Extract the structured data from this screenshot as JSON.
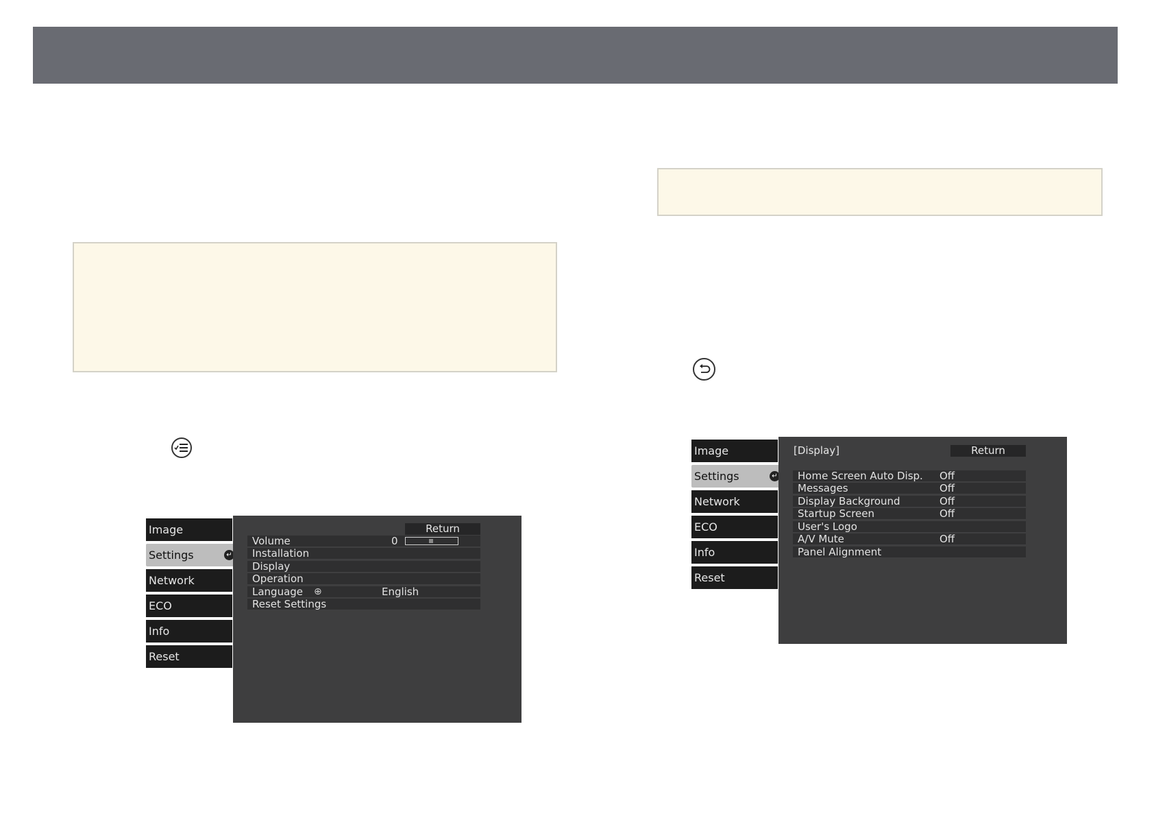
{
  "menu_screen_left": {
    "tabs": [
      "Image",
      "Settings",
      "Network",
      "ECO",
      "Info",
      "Reset"
    ],
    "active_tab": "Settings",
    "return_label": "Return",
    "rows": [
      {
        "label": "Volume",
        "value": "0"
      },
      {
        "label": "Installation",
        "value": ""
      },
      {
        "label": "Display",
        "value": ""
      },
      {
        "label": "Operation",
        "value": ""
      },
      {
        "label": "Language",
        "value": "English"
      },
      {
        "label": "Reset Settings",
        "value": ""
      }
    ],
    "volume_level": 0
  },
  "menu_screen_right": {
    "tabs": [
      "Image",
      "Settings",
      "Network",
      "ECO",
      "Info",
      "Reset"
    ],
    "active_tab": "Settings",
    "section_title": "[Display]",
    "return_label": "Return",
    "rows": [
      {
        "label": "Home Screen Auto Disp.",
        "value": "Off"
      },
      {
        "label": "Messages",
        "value": "Off"
      },
      {
        "label": "Display Background",
        "value": "Off"
      },
      {
        "label": "Startup Screen",
        "value": "Off"
      },
      {
        "label": "User's Logo",
        "value": ""
      },
      {
        "label": "A/V Mute",
        "value": "Off"
      },
      {
        "label": "Panel Alignment",
        "value": ""
      }
    ]
  },
  "icons": {
    "menu_button": "menu-list-icon",
    "back_button": "back-arrow-icon",
    "enter": "enter-icon",
    "globe": "globe-icon"
  },
  "colors": {
    "header": "#696b72",
    "note_bg": "#fdf8e8",
    "osd_panel": "#3e3e3f",
    "osd_tab": "#1c1c1c",
    "osd_tab_active": "#bdbdbd"
  }
}
